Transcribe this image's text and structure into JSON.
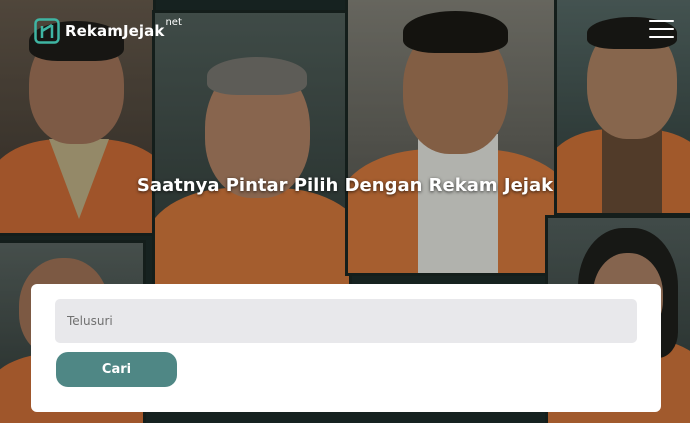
{
  "header": {
    "logo_text": "RekamJejak",
    "logo_suffix": "net",
    "menu_icon": "hamburger-icon"
  },
  "hero": {
    "headline": "Saatnya Pintar Pilih Dengan Rekam Jejak"
  },
  "search": {
    "placeholder": "Telusuri",
    "value": "",
    "button_label": "Cari"
  },
  "colors": {
    "accent": "#4f8785",
    "logo_mark": "#3fb5a3",
    "jacket": "#e0793a",
    "input_bg": "#e8e8eb"
  }
}
